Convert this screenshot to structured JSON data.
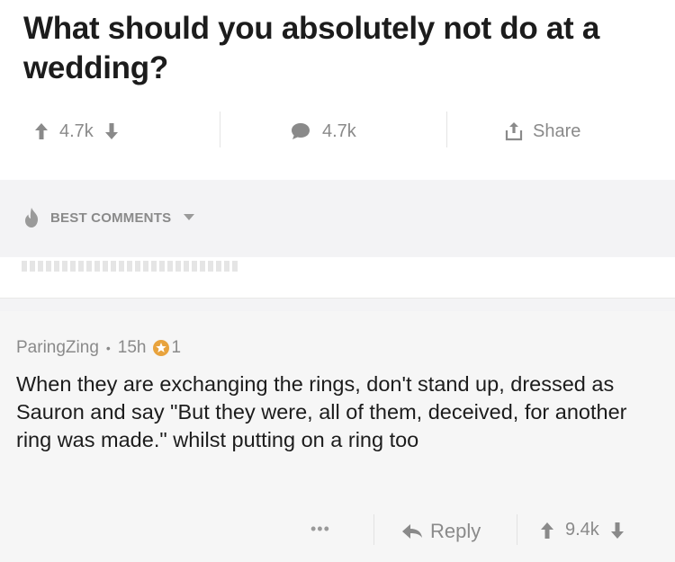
{
  "post": {
    "title": "What should you absolutely not do at a wedding?",
    "upvotes": "4.7k",
    "comments": "4.7k",
    "share_label": "Share"
  },
  "sort": {
    "label": "BEST COMMENTS"
  },
  "comment": {
    "author": "ParingZing",
    "separator": "•",
    "age": "15h",
    "awards": "1",
    "body": "When they are exchanging the rings, don't stand up, dressed as Sauron and say \"But they were, all of them, deceived, for another ring was made.\" whilst putting on a ring too",
    "more_label": "•••",
    "reply_label": "Reply",
    "score": "9.4k"
  },
  "colors": {
    "text_primary": "#1c1c1c",
    "text_muted": "#8a8a8a",
    "band_gray": "#f3f3f5",
    "comment_bg": "#f6f6f6"
  },
  "icons": {
    "upvote": "arrow-up-icon",
    "downvote": "arrow-down-icon",
    "comments": "speech-bubble-icon",
    "share": "share-icon",
    "best": "flame-icon",
    "dropdown": "caret-down-icon",
    "award": "award-icon",
    "reply": "reply-arrow-icon"
  }
}
